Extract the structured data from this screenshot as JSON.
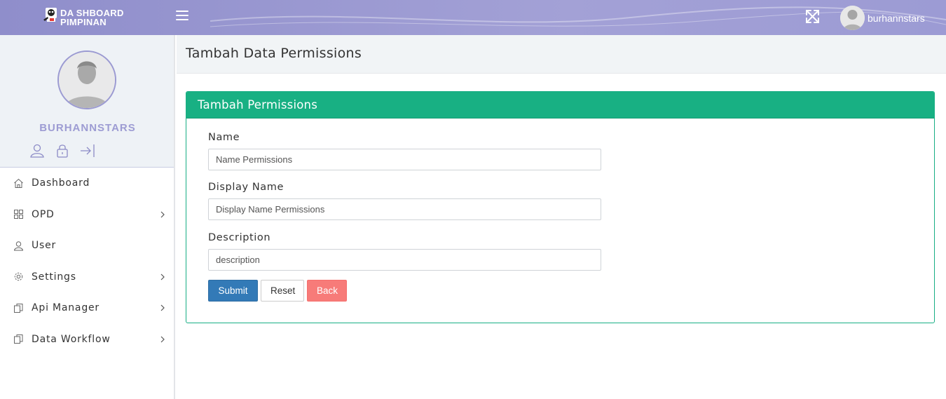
{
  "topbar": {
    "logo_line1": "DA SHBOARD",
    "logo_line2": "PIMPINAN",
    "menu_toggle_icon": "hamburger-icon",
    "fullscreen_icon": "expand-icon",
    "username": "burhannstars"
  },
  "sidebar": {
    "profile_name": "BURHANNSTARS",
    "profile_icons": [
      "user-icon",
      "lock-icon",
      "logout-icon"
    ],
    "items": [
      {
        "label": "Dashboard",
        "icon": "home-icon",
        "has_submenu": false
      },
      {
        "label": "OPD",
        "icon": "grid-icon",
        "has_submenu": true
      },
      {
        "label": "User",
        "icon": "user-icon",
        "has_submenu": false
      },
      {
        "label": "Settings",
        "icon": "gear-icon",
        "has_submenu": true
      },
      {
        "label": "Api Manager",
        "icon": "copy-icon",
        "has_submenu": true
      },
      {
        "label": "Data Workflow",
        "icon": "copy-icon",
        "has_submenu": true
      }
    ]
  },
  "page": {
    "title": "Tambah Data Permissions"
  },
  "form": {
    "card_title": "Tambah Permissions",
    "fields": [
      {
        "label": "Name",
        "placeholder": "Name Permissions",
        "value": ""
      },
      {
        "label": "Display Name",
        "placeholder": "Display Name Permissions",
        "value": ""
      },
      {
        "label": "Description",
        "placeholder": "description",
        "value": ""
      }
    ],
    "buttons": {
      "submit": "Submit",
      "reset": "Reset",
      "back": "Back"
    }
  },
  "colors": {
    "topbar": "#9b9ad2",
    "card_header": "#18b083",
    "submit": "#337ab7",
    "back": "#f77b79"
  }
}
